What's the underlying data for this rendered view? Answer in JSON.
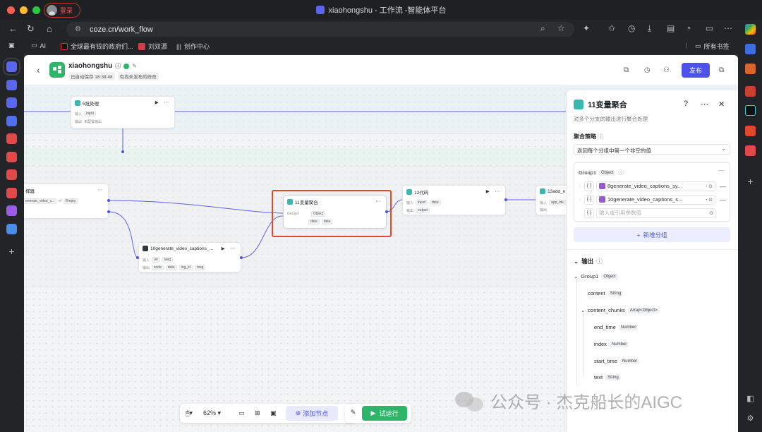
{
  "browser": {
    "window_title": "xiaohongshu - 工作流 -智能体平台",
    "login_label": "登录",
    "url": "coze.cn/work_flow",
    "bookmarks": [
      {
        "label": "AI",
        "icon": "folder-icon"
      },
      {
        "label": "全球最有钱的政府们...",
        "icon": "douyin-icon"
      },
      {
        "label": "刘双源",
        "icon": "bookmark-red-icon"
      },
      {
        "label": "创作中心",
        "icon": "audio-icon"
      }
    ],
    "bookmarks_right": "所有书签",
    "colors": {
      "close": "#ff5f57",
      "minimize": "#febc2e",
      "maximize": "#28c840"
    }
  },
  "header": {
    "app_name": "xiaohongshu",
    "autosave": "已自动保存 18:38:48",
    "unpublished": "有尚未发布的修改",
    "publish_label": "发布"
  },
  "nodes": {
    "n5": {
      "title": "5批处理",
      "row1_label": "输入",
      "row1_tag": "input",
      "row2_label": "输出",
      "row2_value": "未配置输出"
    },
    "selector": {
      "title": "择器",
      "cond_left": "enerate_video_c...",
      "cond_op": "el",
      "cond_right": "Empty"
    },
    "n10": {
      "title": "10generate_video_captions_...",
      "in_label": "输入",
      "in_tags": [
        "url",
        "lang"
      ],
      "out_label": "输出",
      "out_tags": [
        "code",
        "data",
        "log_id",
        "msg"
      ]
    },
    "n11": {
      "title": "11变量聚合",
      "group_label": "Group1",
      "group_type": "Object",
      "tags": [
        "data",
        "data"
      ]
    },
    "n12": {
      "title": "12代码",
      "in_label": "输入",
      "in_tags": [
        "input",
        "data"
      ],
      "out_label": "输出",
      "out_tags": [
        "output"
      ]
    },
    "n13": {
      "title": "13add_n",
      "in_label": "输入",
      "in_tags": [
        "app_tok"
      ],
      "out_label": "输出"
    }
  },
  "toolbar": {
    "zoom": "62%",
    "add_node_label": "添加节点",
    "run_label": "试运行"
  },
  "panel": {
    "title": "11变量聚合",
    "description": "对多个分支的输出进行聚合处理",
    "strategy_label": "聚合策略",
    "strategy_value": "返回每个分组中第一个非空的值",
    "group_name": "Group1",
    "group_type": "Object",
    "vars": [
      "8generate_video_captions_sy...",
      "10generate_video_captions_s..."
    ],
    "var_placeholder": "输入或引用参数值",
    "add_group_label": "新增分组",
    "output_label": "输出",
    "output_tree": [
      {
        "name": "Group1",
        "type": "Object"
      },
      {
        "name": "content",
        "type": "String"
      },
      {
        "name": "content_chunks",
        "type": "Array<Object>"
      },
      {
        "name": "end_time",
        "type": "Number"
      },
      {
        "name": "index",
        "type": "Number"
      },
      {
        "name": "start_time",
        "type": "Number"
      },
      {
        "name": "text",
        "type": "String"
      }
    ]
  },
  "watermark": "公众号 · 杰克船长的AIGC"
}
